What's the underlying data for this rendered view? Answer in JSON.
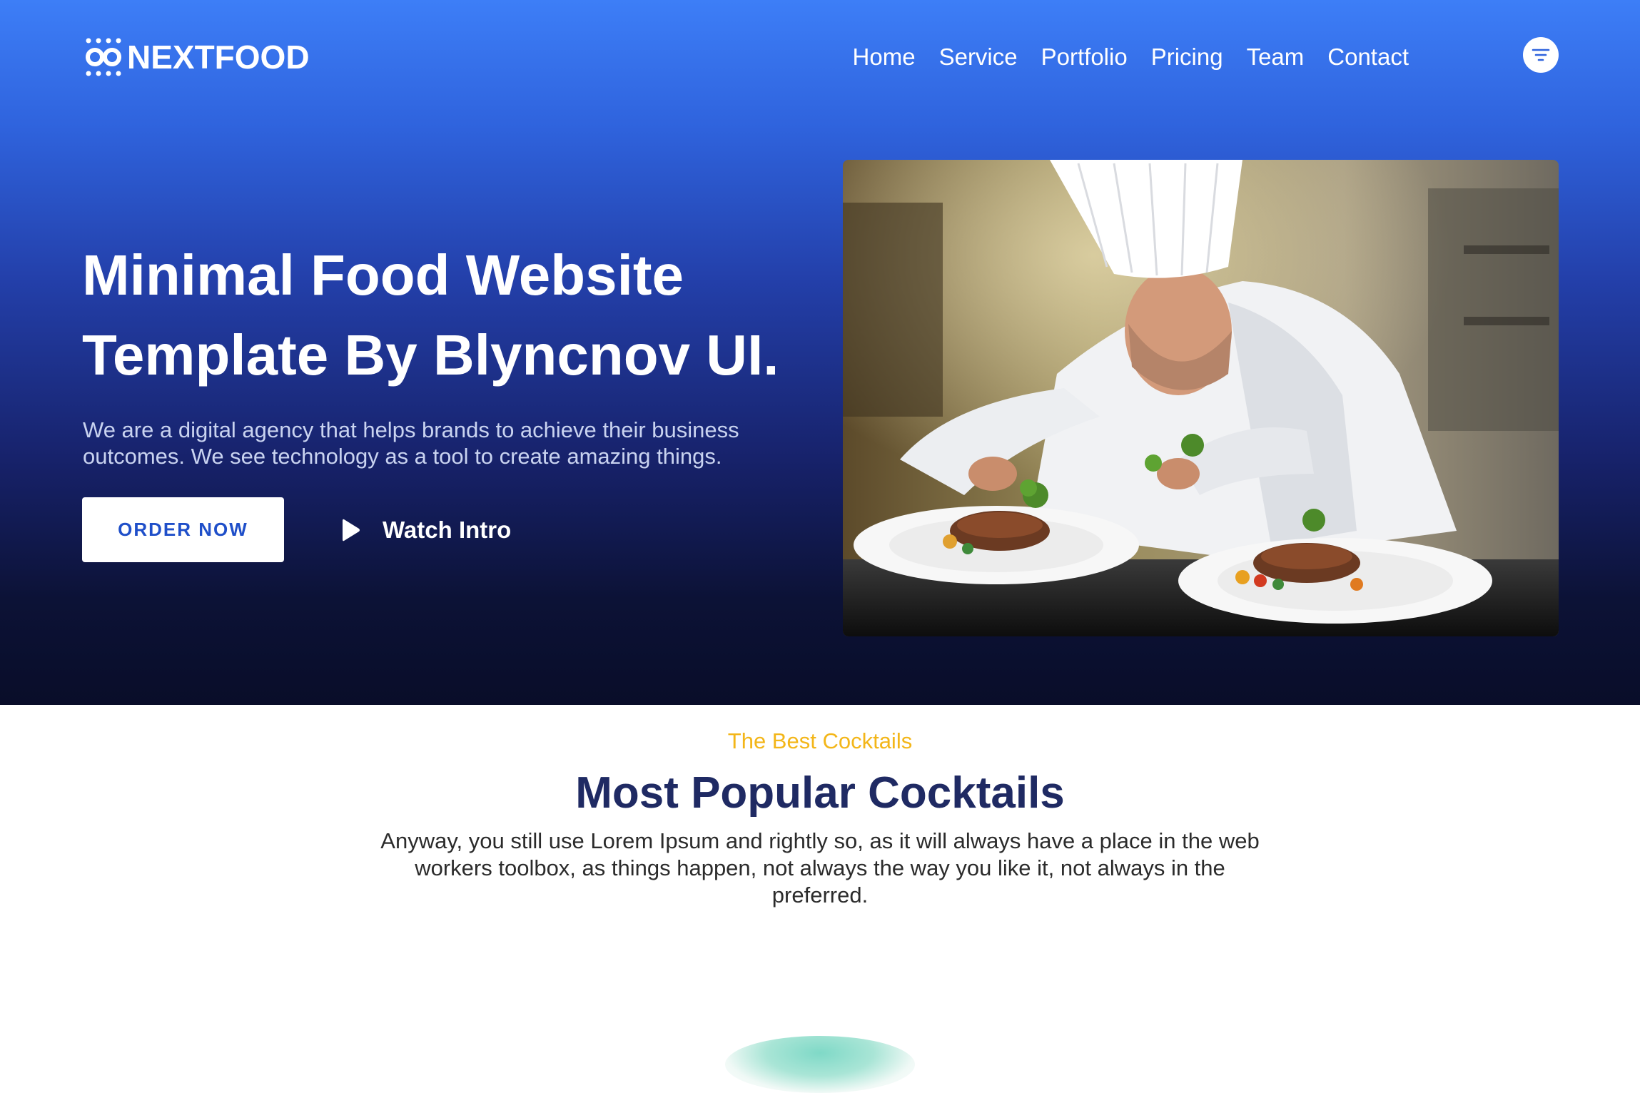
{
  "header": {
    "logo_text": "NEXTFOOD",
    "nav": [
      "Home",
      "Service",
      "Portfolio",
      "Pricing",
      "Team",
      "Contact"
    ],
    "menu_icon": "filter-icon"
  },
  "hero": {
    "title_line1": "Minimal Food Website",
    "title_line2": "Template By Blyncnov UI.",
    "description": "We are a digital agency that helps brands to achieve their business outcomes. We see technology as a tool to create amazing things.",
    "order_button": "ORDER NOW",
    "watch_label": "Watch Intro",
    "image_subject": "chef plating food"
  },
  "popular": {
    "kicker": "The Best Cocktails",
    "title": "Most Popular Cocktails",
    "description": "Anyway, you still use Lorem Ipsum and rightly so, as it will always have a place in the web workers toolbox, as things happen, not always the way you like it, not always in the preferred."
  },
  "colors": {
    "hero_top": "#3d7ef7",
    "hero_bottom": "#090d29",
    "accent_yellow": "#f3b619",
    "title_navy": "#1f2a63",
    "button_text": "#1f4fc9"
  }
}
